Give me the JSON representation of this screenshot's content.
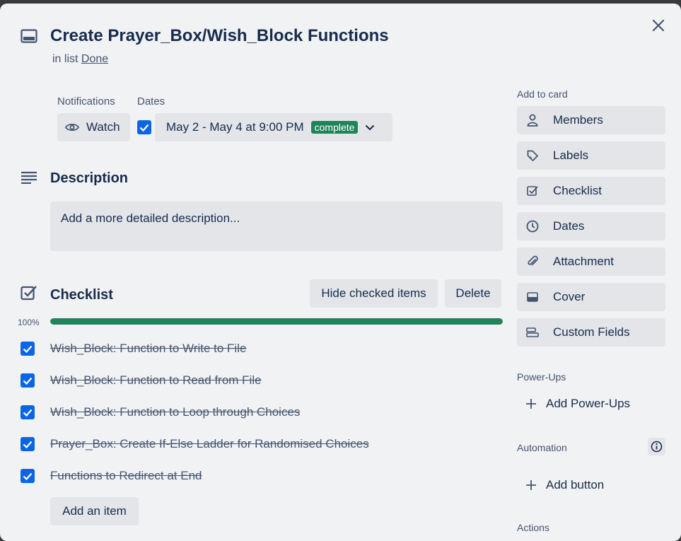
{
  "card": {
    "title": "Create Prayer_Box/Wish_Block Functions",
    "in_list_prefix": "in list",
    "list_name": "Done"
  },
  "notifications": {
    "label": "Notifications",
    "watch_label": "Watch"
  },
  "dates": {
    "label": "Dates",
    "value": "May 2 - May 4 at 9:00 PM",
    "badge": "complete",
    "checked": true
  },
  "description": {
    "heading": "Description",
    "placeholder": "Add a more detailed description..."
  },
  "checklist": {
    "heading": "Checklist",
    "hide_checked_label": "Hide checked items",
    "delete_label": "Delete",
    "progress_percent_label": "100%",
    "progress_value": 1.0,
    "items": [
      {
        "text": "Wish_Block: Function to Write to File",
        "checked": true
      },
      {
        "text": "Wish_Block: Function to Read from File",
        "checked": true
      },
      {
        "text": "Wish_Block: Function to Loop through Choices",
        "checked": true
      },
      {
        "text": "Prayer_Box: Create If-Else Ladder for Randomised Choices",
        "checked": true
      },
      {
        "text": "Functions to Redirect at End",
        "checked": true
      }
    ],
    "add_item_label": "Add an item"
  },
  "sidebar": {
    "add_to_card_label": "Add to card",
    "buttons": [
      {
        "label": "Members",
        "icon": "person-icon"
      },
      {
        "label": "Labels",
        "icon": "tag-icon"
      },
      {
        "label": "Checklist",
        "icon": "checklist-icon"
      },
      {
        "label": "Dates",
        "icon": "clock-icon"
      },
      {
        "label": "Attachment",
        "icon": "paperclip-icon"
      },
      {
        "label": "Cover",
        "icon": "cover-icon"
      },
      {
        "label": "Custom Fields",
        "icon": "custom-fields-icon"
      }
    ],
    "power_ups_label": "Power-Ups",
    "add_power_ups_label": "Add Power-Ups",
    "automation_label": "Automation",
    "add_button_label": "Add button",
    "actions_label": "Actions"
  },
  "colors": {
    "accent": "#0c66e4",
    "success": "#1f845a",
    "background": "#f1f2f4",
    "button_bg": "#e3e5e9"
  }
}
